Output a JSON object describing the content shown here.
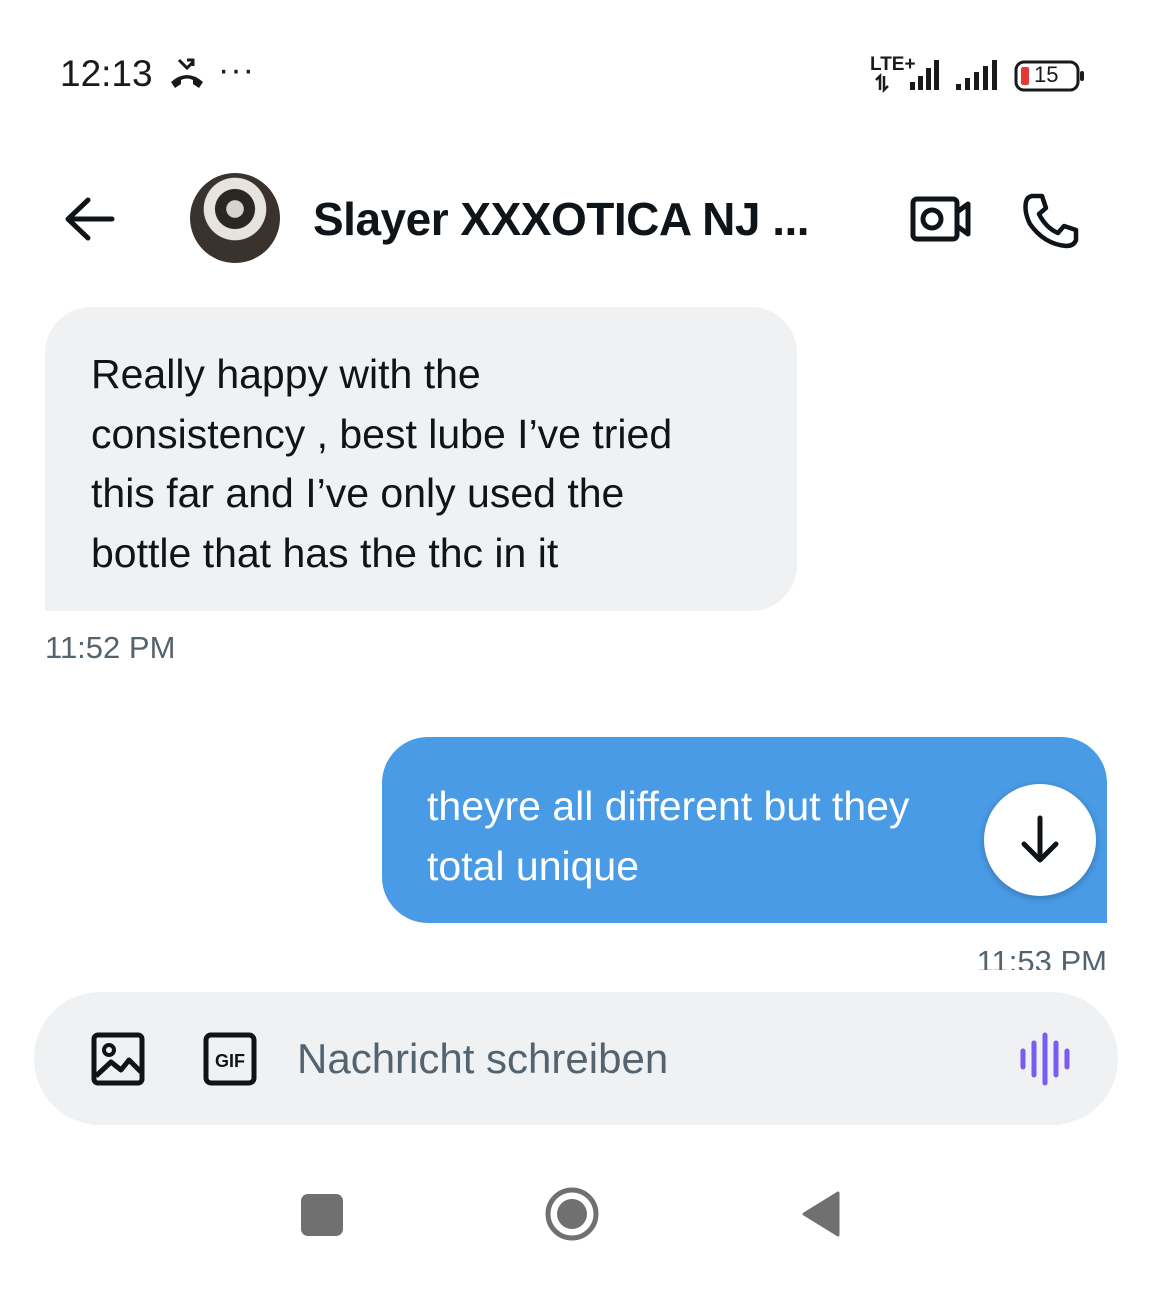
{
  "status_bar": {
    "time": "12:13",
    "more": "···",
    "network": "LTE+",
    "battery": "15"
  },
  "header": {
    "contact_name": "Slayer XXXOTICA NJ ...",
    "icons": [
      "back-arrow-icon",
      "video-call-icon",
      "phone-icon"
    ]
  },
  "messages": [
    {
      "direction": "incoming",
      "text": "Really happy with the\nconsistency , best lube I’ve tried\nthis far and I’ve only used the\nbottle that has the thc in it",
      "time": "11:52 PM"
    },
    {
      "direction": "outgoing",
      "text": "theyre all different but they\ntotal unique",
      "time": "11:53 PM"
    }
  ],
  "composer": {
    "placeholder": "Nachricht schreiben",
    "gif_label": "GIF",
    "icons": [
      "image-icon",
      "gif-icon",
      "voice-message-icon"
    ]
  },
  "colors": {
    "incoming_bubble": "#eff1f3",
    "outgoing_bubble": "#4a9be6",
    "voice_icon": "#7b5cf0",
    "battery_low": "#e53935"
  }
}
